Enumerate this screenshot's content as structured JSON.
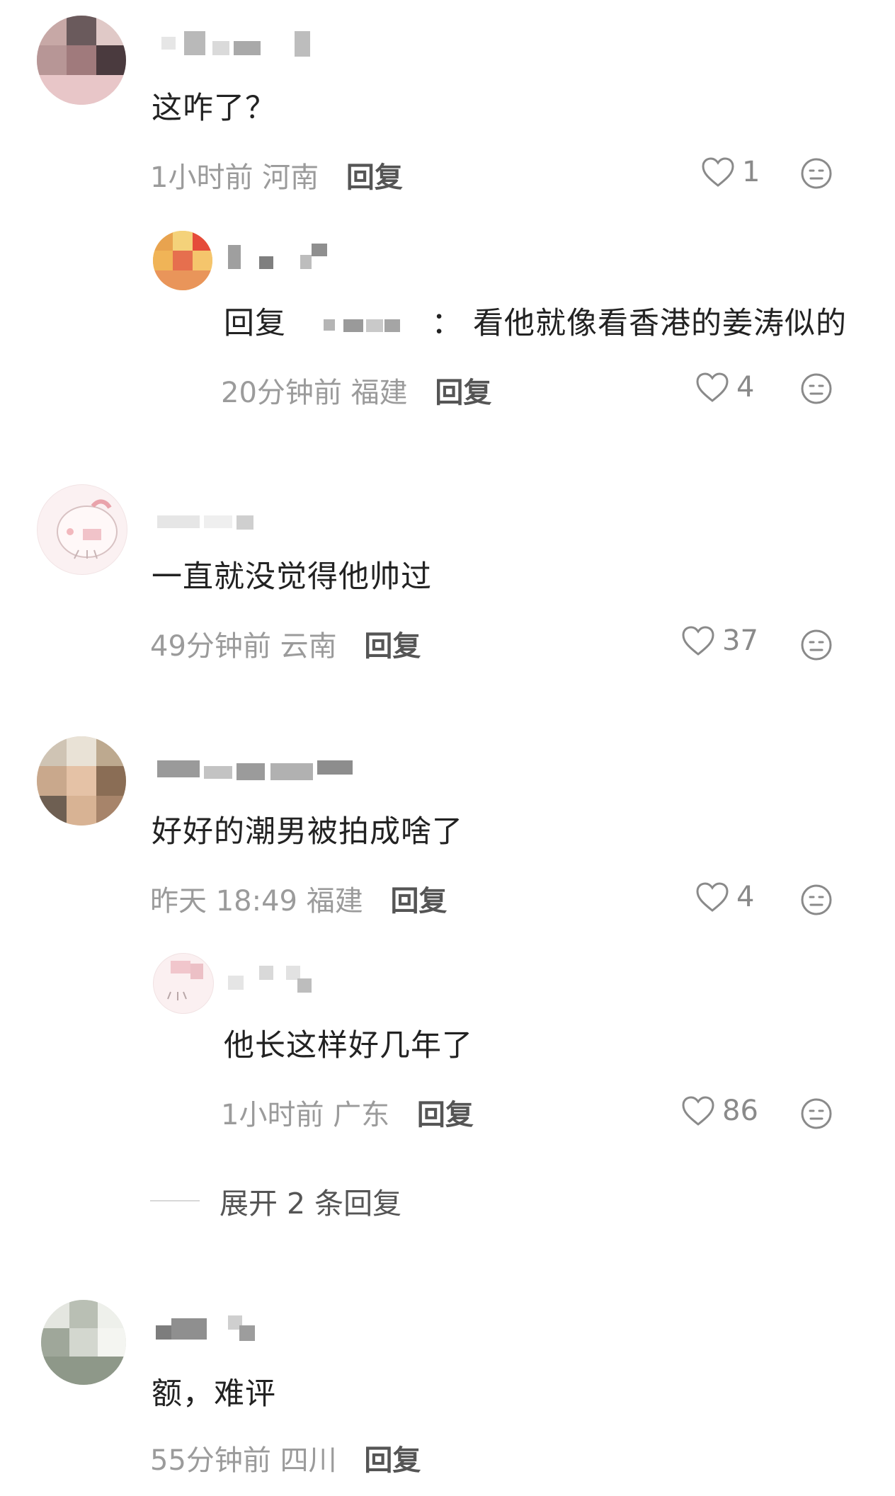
{
  "comments": [
    {
      "text": "这咋了？",
      "time": "1小时前",
      "location": "河南",
      "reply_label": "回复",
      "likes": "1"
    },
    {
      "reply_prefix": "回复",
      "reply_colon": "：",
      "text": "看他就像看香港的姜涛似的",
      "time": "20分钟前",
      "location": "福建",
      "reply_label": "回复",
      "likes": "4"
    },
    {
      "text": "一直就没觉得他帅过",
      "time": "49分钟前",
      "location": "云南",
      "reply_label": "回复",
      "likes": "37"
    },
    {
      "text": "好好的潮男被拍成啥了",
      "time": "昨天 18:49",
      "location": "福建",
      "reply_label": "回复",
      "likes": "4"
    },
    {
      "text": "他长这样好几年了",
      "time": "1小时前",
      "location": "广东",
      "reply_label": "回复",
      "likes": "86"
    },
    {
      "text": "额，难评",
      "time": "55分钟前",
      "location": "四川",
      "reply_label": "回复",
      "likes": ""
    }
  ],
  "expand_replies": "展开 2 条回复",
  "icons": {
    "like": "heart-outline-icon",
    "react": "neutral-face-icon"
  },
  "colors": {
    "text": "#222222",
    "meta": "#9b9b9b",
    "reply": "#555555",
    "background": "#ffffff"
  }
}
